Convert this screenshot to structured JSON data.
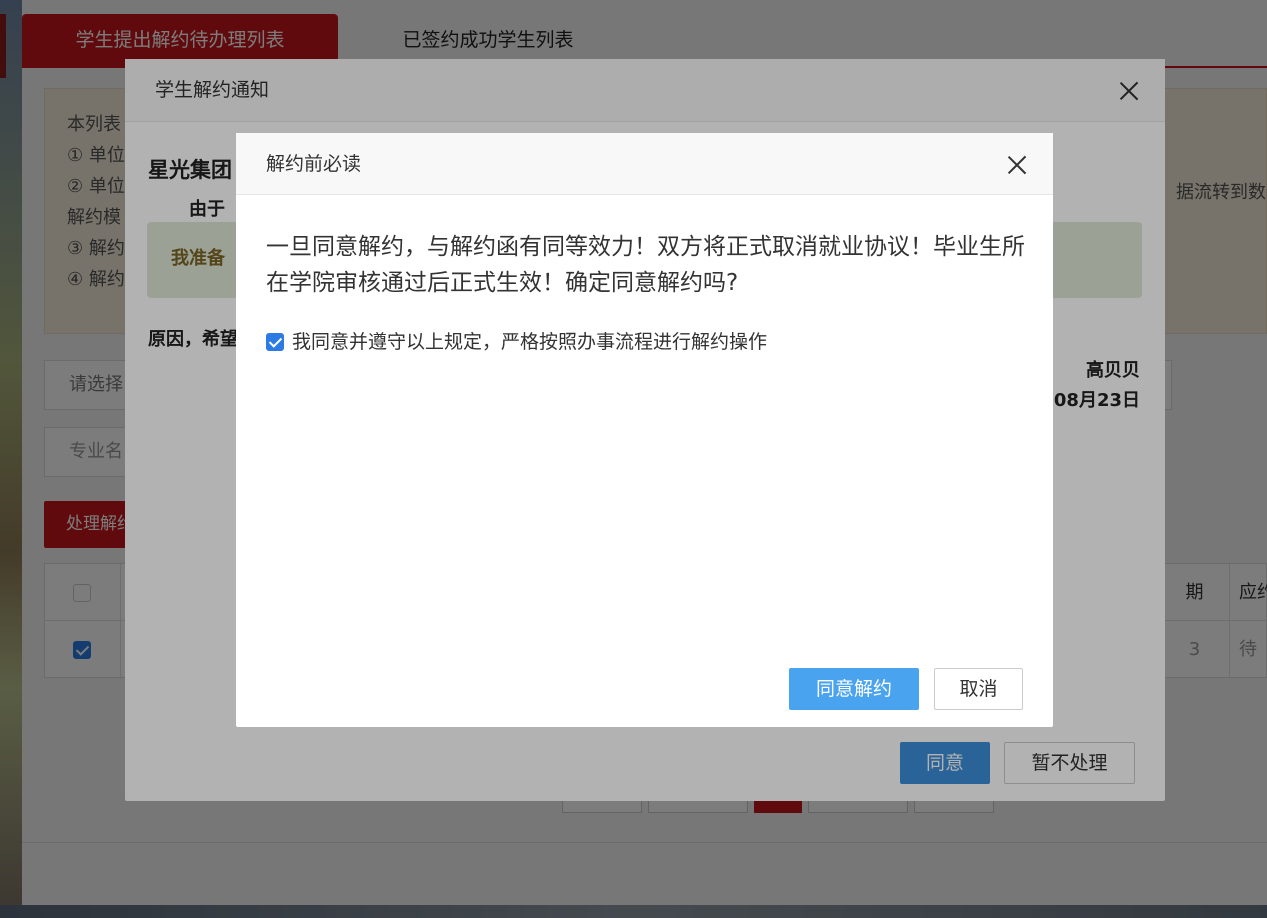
{
  "background": {
    "tabs": [
      {
        "label": "学生提出解约待办理列表",
        "active": true
      },
      {
        "label": "已签约成功学生列表",
        "active": false
      }
    ],
    "notice": {
      "line1": "本列表",
      "line2": "① 单位",
      "line3": "② 单位",
      "line4": "解约模",
      "line5": "③ 解约",
      "line6": "④ 解约",
      "right_text": "据流转到数"
    },
    "filter": {
      "select_placeholder": "请选择",
      "major_placeholder": "专业名"
    },
    "process_button": "处理解约",
    "table": {
      "header_date": "期",
      "header_status": "应约",
      "row_date": "3",
      "row_status": "待"
    }
  },
  "notice_modal": {
    "title": "学生解约通知",
    "company": "星光集团",
    "reason_intro": "由于",
    "green_text": "我准备",
    "reason_line": "原因，希望",
    "signer": "高贝贝",
    "date": "08月23日",
    "agree_label": "同意",
    "later_label": "暂不处理"
  },
  "confirm_modal": {
    "title": "解约前必读",
    "warning": "一旦同意解约，与解约函有同等效力！双方将正式取消就业协议！毕业生所在学院审核通过后正式生效！确定同意解约吗?",
    "agreement_label": "我同意并遵守以上规定，严格按照办事流程进行解约操作",
    "agreement_checked": true,
    "confirm_label": "同意解约",
    "cancel_label": "取消"
  },
  "colors": {
    "brand_red": "#c8161d",
    "primary_blue": "#4aa3ef",
    "notice_bg": "#f6ecdc",
    "green_box": "#dfe9d6"
  }
}
